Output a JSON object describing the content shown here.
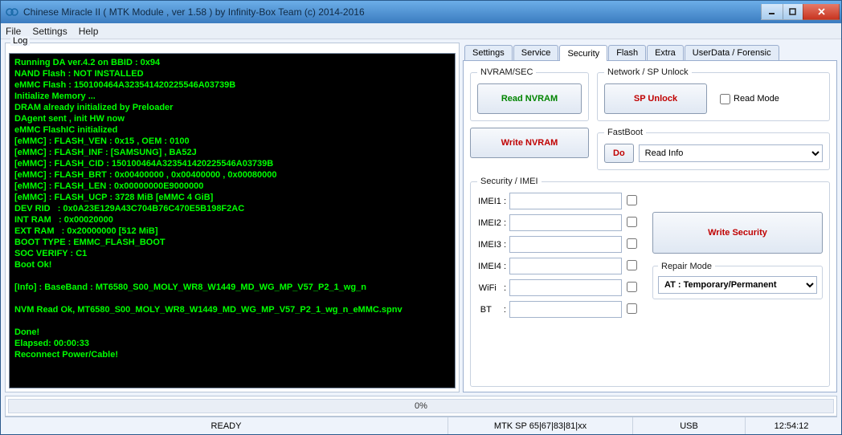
{
  "window": {
    "title": "Chinese Miracle II ( MTK Module , ver 1.58 ) by Infinity-Box Team (c) 2014-2016"
  },
  "menu": {
    "file": "File",
    "settings": "Settings",
    "help": "Help"
  },
  "log_label": "Log",
  "log_text": "Running DA ver.4.2 on BBID : 0x94\nNAND Flash : NOT INSTALLED\neMMC Flash : 150100464A323541420225546A03739B\nInitialize Memory ...\nDRAM already initialized by Preloader\nDAgent sent , init HW now\neMMC FlashIC initialized\n[eMMC] : FLASH_VEN : 0x15 , OEM : 0100\n[eMMC] : FLASH_INF : [SAMSUNG] , BA52J\n[eMMC] : FLASH_CID : 150100464A323541420225546A03739B\n[eMMC] : FLASH_BRT : 0x00400000 , 0x00400000 , 0x00080000\n[eMMC] : FLASH_LEN : 0x00000000E9000000\n[eMMC] : FLASH_UCP : 3728 MiB [eMMC 4 GiB]\nDEV RID   : 0x0A23E129A43C704B76C470E5B198F2AC\nINT RAM   : 0x00020000\nEXT RAM   : 0x20000000 [512 MiB]\nBOOT TYPE : EMMC_FLASH_BOOT\nSOC VERIFY : C1\nBoot Ok!\n\n[Info] : BaseBand : MT6580_S00_MOLY_WR8_W1449_MD_WG_MP_V57_P2_1_wg_n\n\nNVM Read Ok, MT6580_S00_MOLY_WR8_W1449_MD_WG_MP_V57_P2_1_wg_n_eMMC.spnv\n\nDone!\nElapsed: 00:00:33\nReconnect Power/Cable!",
  "tabs": {
    "settings": "Settings",
    "service": "Service",
    "security": "Security",
    "flash": "Flash",
    "extra": "Extra",
    "userdata": "UserData / Forensic"
  },
  "panel": {
    "nvram_legend": "NVRAM/SEC",
    "read_nvram": "Read NVRAM",
    "write_nvram": "Write NVRAM",
    "network_legend": "Network / SP Unlock",
    "sp_unlock": "SP Unlock",
    "read_mode": "Read Mode",
    "fastboot_legend": "FastBoot",
    "do": "Do",
    "read_info": "Read Info",
    "security_legend": "Security / IMEI",
    "imei1": "IMEI1 :",
    "imei2": "IMEI2 :",
    "imei3": "IMEI3 :",
    "imei4": "IMEI4 :",
    "wifi": "WiFi   :",
    "bt": "BT     :",
    "write_security": "Write Security",
    "repair_legend": "Repair Mode",
    "repair_option": "AT  : Temporary/Permanent"
  },
  "progress": "0%",
  "status": {
    "ready": "READY",
    "chip": "MTK SP 65|67|83|81|xx",
    "conn": "USB",
    "time": "12:54:12"
  }
}
